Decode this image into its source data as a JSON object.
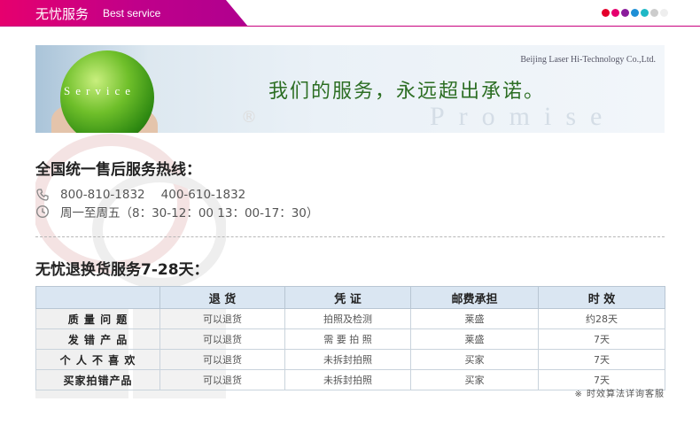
{
  "header": {
    "title": "无忧服务",
    "subtitle": "Best service",
    "dot_colors": [
      "#e4002b",
      "#e6006e",
      "#8a1c9b",
      "#1e8fd6",
      "#1fb8c6",
      "#cccccc",
      "#eeeeee"
    ]
  },
  "banner": {
    "service_text": "Service",
    "company": "Beijing Laser Hi-Technology Co.,Ltd.",
    "slogan": "我们的服务，永远超出承诺。",
    "promise_text": "Promise",
    "registered_mark": "®"
  },
  "hotline": {
    "heading": "全国统一售后服务热线：",
    "phone_1": "800-810-1832",
    "phone_2": "400-610-1832",
    "hours": "周一至周五（8：30-12：00  13：00-17：30）"
  },
  "returns": {
    "heading": "无忧退换货服务7-28天：",
    "columns": [
      "",
      "退 货",
      "凭 证",
      "邮费承担",
      "时 效"
    ],
    "rows": [
      {
        "label": "质 量 问 题",
        "return": "可以退货",
        "proof": "拍照及检测",
        "postage": "莱盛",
        "period": "约28天"
      },
      {
        "label": "发 错 产 品",
        "return": "可以退货",
        "proof": "需 要 拍 照",
        "postage": "莱盛",
        "period": "7天"
      },
      {
        "label": "个 人 不 喜 欢",
        "return": "可以退货",
        "proof": "未拆封拍照",
        "postage": "买家",
        "period": "7天"
      },
      {
        "label": "买家拍错产品",
        "return": "可以退货",
        "proof": "未拆封拍照",
        "postage": "买家",
        "period": "7天"
      }
    ],
    "note": "※ 时效算法详询客服"
  }
}
